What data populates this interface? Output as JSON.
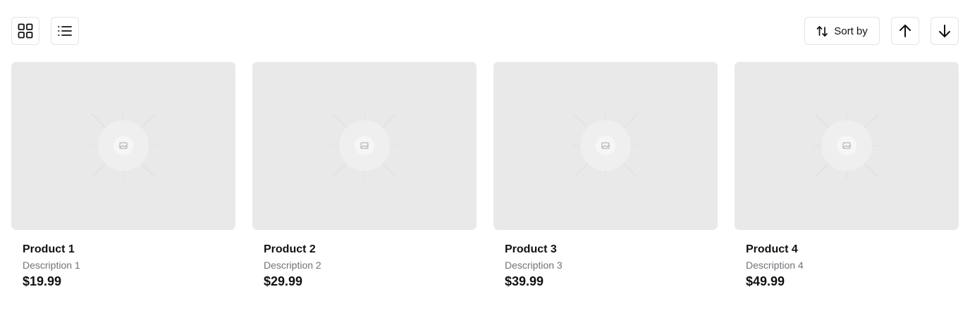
{
  "toolbar": {
    "view_grid_icon": "grid-icon",
    "view_list_icon": "list-icon",
    "sort_label": "Sort by",
    "sort_icon": "arrows-up-down-icon",
    "sort_asc_icon": "arrow-up-icon",
    "sort_desc_icon": "arrow-down-icon"
  },
  "products": [
    {
      "name": "Product 1",
      "description": "Description 1",
      "price": "$19.99"
    },
    {
      "name": "Product 2",
      "description": "Description 2",
      "price": "$29.99"
    },
    {
      "name": "Product 3",
      "description": "Description 3",
      "price": "$39.99"
    },
    {
      "name": "Product 4",
      "description": "Description 4",
      "price": "$49.99"
    }
  ],
  "colors": {
    "placeholder_bg": "#e9e9e9",
    "border": "#e4e4e7",
    "muted_text": "#71717a",
    "text": "#111111"
  }
}
